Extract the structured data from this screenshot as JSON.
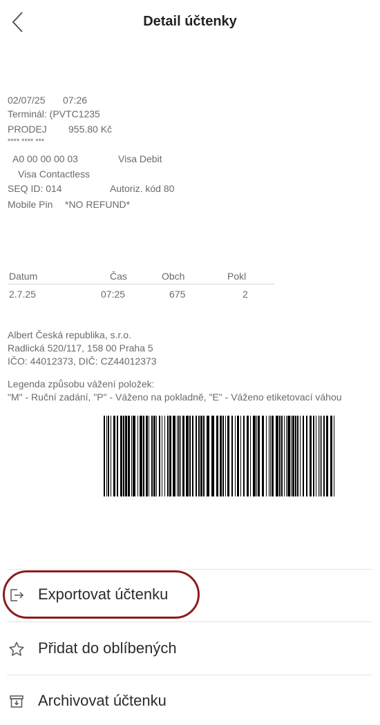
{
  "header": {
    "title": "Detail účtenky"
  },
  "receipt": {
    "date": "02/07/25",
    "time": "07:26",
    "terminal": "Terminál: (PVTC1235",
    "sale_label": "PRODEJ",
    "amount": "955.80 Kč",
    "masked_card": "**** **** ***",
    "aid": "A0 00 00 00 03",
    "card_type": "Visa Debit",
    "contactless": "Visa Contactless",
    "seq": "SEQ ID: 014",
    "auth": "Autoriz. kód 80",
    "pin": "Mobile Pin",
    "refund": "*NO REFUND*",
    "table_headers": [
      "Datum",
      "Čas",
      "Obch",
      "Pokl"
    ],
    "table_values": [
      "2.7.25",
      "07:25",
      "675",
      "2"
    ],
    "company": "Albert Česká republika, s.r.o.",
    "address": "Radlická 520/117, 158 00 Praha 5",
    "ids": "IČO: 44012373, DIČ: CZ44012373",
    "legend_title": "Legenda způsobu vážení položek:",
    "legend_text": "\"M\" - Ruční zadání, \"P\" - Váženo na pokladně, \"E\" - Váženo etiketovací váhou"
  },
  "actions": {
    "export": "Exportovat účtenku",
    "favorite": "Přidat do oblíbených",
    "archive": "Archivovat účtenku"
  },
  "colors": {
    "highlight": "#8b1c1c",
    "receipt_text": "#6a6a6a"
  },
  "icons": {
    "back": "chevron-left-icon",
    "export": "export-icon",
    "favorite": "star-icon",
    "archive": "archive-icon"
  }
}
